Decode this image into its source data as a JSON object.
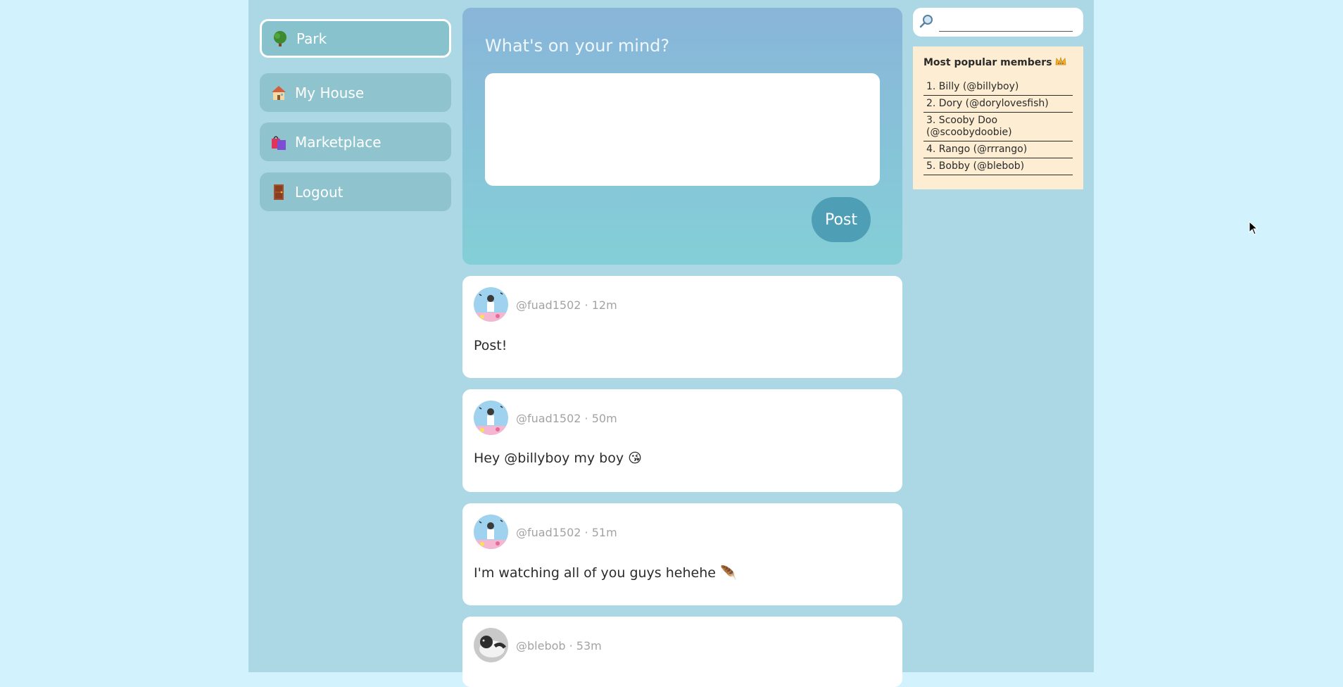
{
  "sidebar": {
    "items": [
      {
        "label": "Park",
        "icon": "tree-icon",
        "active": true
      },
      {
        "label": "My House",
        "icon": "house-icon",
        "active": false
      },
      {
        "label": "Marketplace",
        "icon": "shopping-bags-icon",
        "active": false
      },
      {
        "label": "Logout",
        "icon": "door-icon",
        "active": false
      }
    ]
  },
  "composer": {
    "title": "What's on your mind?",
    "input_value": "",
    "post_label": "Post"
  },
  "feed": {
    "posts": [
      {
        "meta": "@fuad1502 · 12m",
        "body": "Post!"
      },
      {
        "meta": "@fuad1502 · 50m",
        "body": "Hey @billyboy my boy 😘"
      },
      {
        "meta": "@fuad1502 · 51m",
        "body": "I'm watching all of you guys hehehe 🪶"
      },
      {
        "meta": "@blebob · 53m",
        "body": ""
      }
    ]
  },
  "search": {
    "value": ""
  },
  "popular": {
    "title": "Most popular members",
    "members": [
      "1. Billy (@billyboy)",
      "2. Dory (@dorylovesfish)",
      "3. Scooby Doo (@scoobydoobie)",
      "4. Rango (@rrrango)",
      "5. Bobby (@blebob)"
    ]
  },
  "colors": {
    "page_bg": "#d2f3fd",
    "app_bg": "#acd8e5",
    "nav_button": "#8fc4cf",
    "post_button": "#4e9fb6",
    "popular_bg": "#fdedd2"
  }
}
